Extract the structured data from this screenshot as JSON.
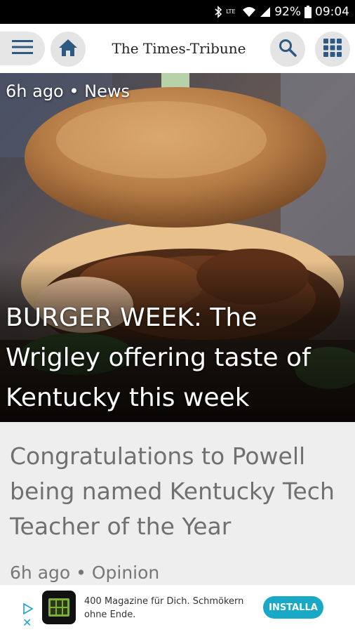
{
  "status_bar": {
    "battery": "92%",
    "time": "09:04",
    "network": "LTE"
  },
  "app_bar": {
    "title": "The Times-Tribune",
    "icons": [
      "menu-icon",
      "home-icon",
      "search-icon",
      "grid-icon"
    ]
  },
  "hero_article": {
    "meta": "6h ago • News",
    "title": "BURGER WEEK: The Wrigley offering taste of Kentucky this week"
  },
  "second_article": {
    "title": "Congratulations to Powell being named Kentucky Tech Teacher of the Year",
    "meta": "6h ago • Opinion"
  },
  "ad": {
    "text": "400 Magazine für Dich. Schmökern ohne Ende.",
    "cta": "INSTALLA",
    "close": "✕"
  },
  "colors": {
    "accent": "#19a8c5",
    "card_bg": "#eeeeee",
    "button_bg": "#e4e4e4"
  }
}
